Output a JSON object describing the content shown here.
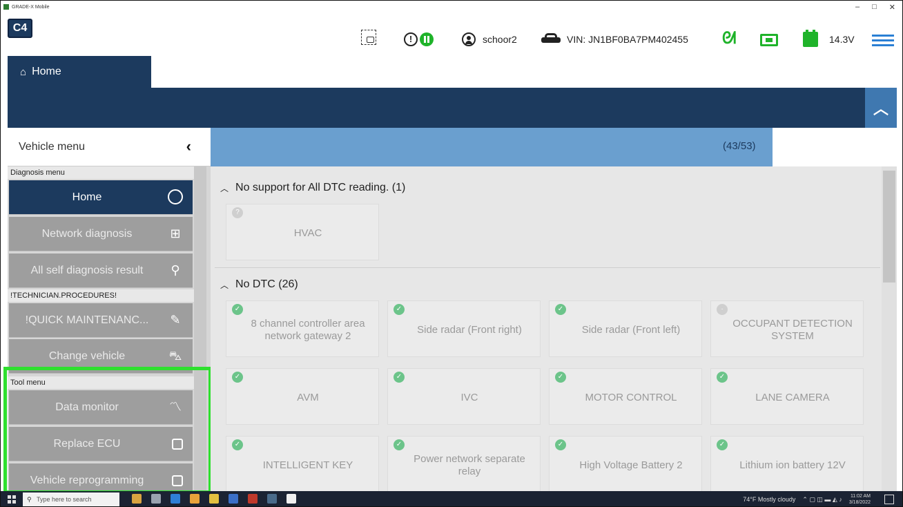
{
  "window": {
    "title": "GRADE-X Mobile",
    "controls": [
      "–",
      "□",
      "✕"
    ]
  },
  "header": {
    "logo": "C4",
    "user": "schoor2",
    "vin": "VIN: JN1BF0BA7PM402455",
    "voltage": "14.3V",
    "alert_icon_text": "!",
    "colors": {
      "navy": "#1c3a5e",
      "accent_blue": "#3f78b0",
      "status_green": "#1fb32a",
      "menu_blue": "#2a7fd4"
    }
  },
  "tab": {
    "home": "Home"
  },
  "sidebar": {
    "title": "Vehicle menu",
    "collapse_icon": "‹",
    "sections": {
      "diagnosis": "Diagnosis menu",
      "technician": "!TECHNICIAN.PROCEDURES!",
      "tool": "Tool menu"
    },
    "items": [
      {
        "label": "Home"
      },
      {
        "label": "Network diagnosis"
      },
      {
        "label": "All self diagnosis result"
      },
      {
        "label": "!QUICK MAINTENANC..."
      },
      {
        "label": "Change vehicle"
      },
      {
        "label": "Data monitor"
      },
      {
        "label": "Replace ECU"
      },
      {
        "label": "Vehicle reprogramming"
      }
    ]
  },
  "main": {
    "count": "(43/53)",
    "groups": [
      {
        "title": "No support for All DTC reading. (1)",
        "ecus": [
          {
            "name": "HVAC"
          }
        ]
      },
      {
        "title": "No DTC (26)",
        "ecus": [
          {
            "name": "8 channel controller area network gateway 2"
          },
          {
            "name": "Side radar (Front right)"
          },
          {
            "name": "Side radar (Front left)"
          },
          {
            "name": "OCCUPANT DETECTION SYSTEM"
          },
          {
            "name": "AVM"
          },
          {
            "name": "IVC"
          },
          {
            "name": "MOTOR CONTROL"
          },
          {
            "name": "LANE CAMERA"
          },
          {
            "name": "INTELLIGENT KEY"
          },
          {
            "name": "Power network separate relay"
          },
          {
            "name": "High Voltage Battery 2"
          },
          {
            "name": "Lithium ion battery 12V"
          }
        ]
      }
    ]
  },
  "taskbar": {
    "search_placeholder": "Type here to search",
    "weather": "74°F  Mostly cloudy",
    "time": "11:02 AM",
    "date": "3/18/2022"
  }
}
